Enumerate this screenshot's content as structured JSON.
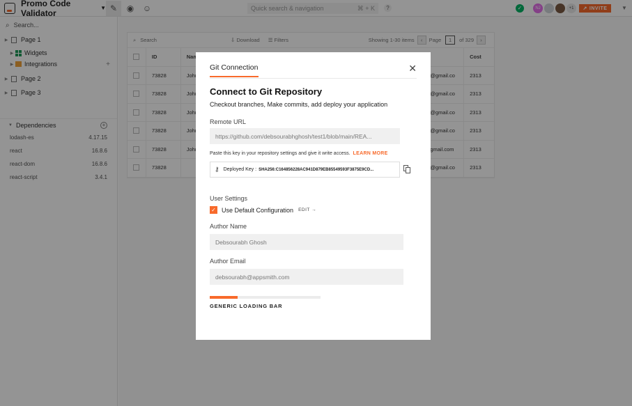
{
  "topbar": {
    "app_name": "Promo Code Validator",
    "search_placeholder": "Quick search & navigation",
    "search_shortcut": "⌘ + K",
    "help": "?",
    "avatars": [
      "NJ",
      "",
      "",
      "+1"
    ],
    "invite": "INVITE"
  },
  "sidebar": {
    "search_placeholder": "Search...",
    "pages": [
      {
        "label": "Page 1"
      },
      {
        "label": "Page 2"
      },
      {
        "label": "Page 3"
      }
    ],
    "sub_items": [
      {
        "label": "Widgets"
      },
      {
        "label": "Integrations"
      }
    ],
    "dependencies_label": "Dependencies",
    "dependencies": [
      {
        "name": "lodash-es",
        "version": "4.17.15"
      },
      {
        "name": "react",
        "version": "16.8.6"
      },
      {
        "name": "react-dom",
        "version": "16.8.6"
      },
      {
        "name": "react-script",
        "version": "3.4.1"
      }
    ]
  },
  "table": {
    "search_placeholder": "Search",
    "download": "Download",
    "filters": "Filters",
    "showing": "Showing 1-30 items",
    "page_label": "Page",
    "page_num": "1",
    "of_pages": "of 329",
    "columns": {
      "id": "ID",
      "name": "Nam",
      "cost": "Cost"
    },
    "rows": [
      {
        "id": "73828",
        "name": "John",
        "email": "@gmail.co",
        "cost": "2313"
      },
      {
        "id": "73828",
        "name": "John",
        "email": "@gmail.co",
        "cost": "2313"
      },
      {
        "id": "73828",
        "name": "John",
        "email": "@gmail.co",
        "cost": "2313"
      },
      {
        "id": "73828",
        "name": "John",
        "email": "@gmail.co",
        "cost": "2313"
      },
      {
        "id": "73828",
        "name": "John",
        "email": "gmail.com",
        "cost": "2313"
      },
      {
        "id": "73828",
        "name": "",
        "email": "@gmail.co",
        "cost": "2313"
      }
    ]
  },
  "modal": {
    "tab": "Git Connection",
    "title": "Connect to Git Repository",
    "subtitle": "Checkout branches, Make commits, add deploy your application",
    "remote_url_label": "Remote URL",
    "remote_url_value": "https://github.com/debsourabhghosh/test1/blob/main/REA...",
    "key_note": "Paste this key in your repository settings and give it write access.",
    "learn_more": "LEARN MORE",
    "deployed_key_label": "Deployed Key :",
    "deployed_key_value": "SHA256:C164856228AC941D879EB85549593F3875E9CD...",
    "user_settings": "User Settings",
    "use_default": "Use Default Configuration",
    "edit": "EDIT",
    "author_name_label": "Author Name",
    "author_name_value": "Debsourabh Ghosh",
    "author_email_label": "Author Email",
    "author_email_value": "debsourabh@appsmith.com",
    "loading_label": "GENERIC LOADING BAR",
    "loading_progress": 0.25
  },
  "colors": {
    "accent": "#f86a2b",
    "success": "#03b365"
  }
}
